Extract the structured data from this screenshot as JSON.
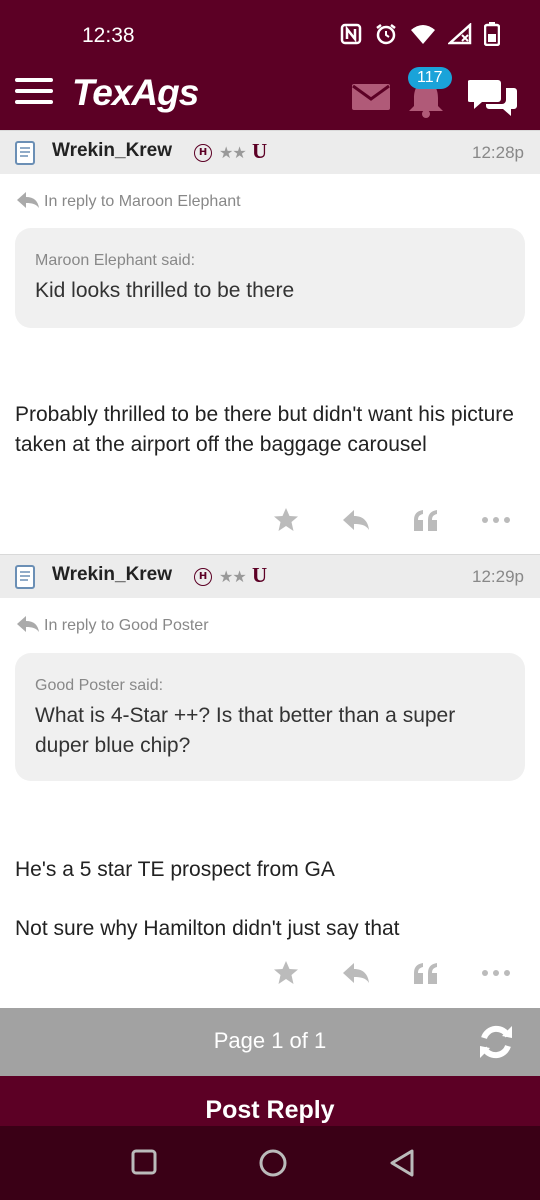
{
  "status_bar": {
    "time": "12:38"
  },
  "header": {
    "logo": "TexAgs",
    "notification_count": "117"
  },
  "posts": [
    {
      "username": "Wrekin_Krew",
      "badge_h": "H",
      "stars": "★★",
      "badge_u": "U",
      "time": "12:28p",
      "reply_to": "In reply to Maroon Elephant",
      "quote_author": "Maroon Elephant said:",
      "quote_text": "Kid looks thrilled to be there",
      "body": [
        "Probably thrilled to be there but didn't want his picture taken at the airport off the baggage carousel"
      ]
    },
    {
      "username": "Wrekin_Krew",
      "badge_h": "H",
      "stars": "★★",
      "badge_u": "U",
      "time": "12:29p",
      "reply_to": "In reply to Good Poster",
      "quote_author": "Good Poster said:",
      "quote_text": "What is 4-Star ++? Is that better than a super duper blue chip?",
      "body": [
        "He's a 5 star TE prospect from GA",
        "Not sure why Hamilton didn't just say that"
      ]
    }
  ],
  "pagination": {
    "label": "Page 1 of 1"
  },
  "footer": {
    "post_reply_label": "Post Reply"
  },
  "icons": [
    "menu-icon",
    "mail-icon",
    "bell-icon",
    "chat-icon",
    "doc-icon",
    "reply-icon",
    "star-icon",
    "quote-icon",
    "more-icon",
    "refresh-icon"
  ],
  "colors": {
    "maroon": "#5c0025",
    "badge_blue": "#1aa3d9",
    "page_bar": "#a2a2a2"
  }
}
